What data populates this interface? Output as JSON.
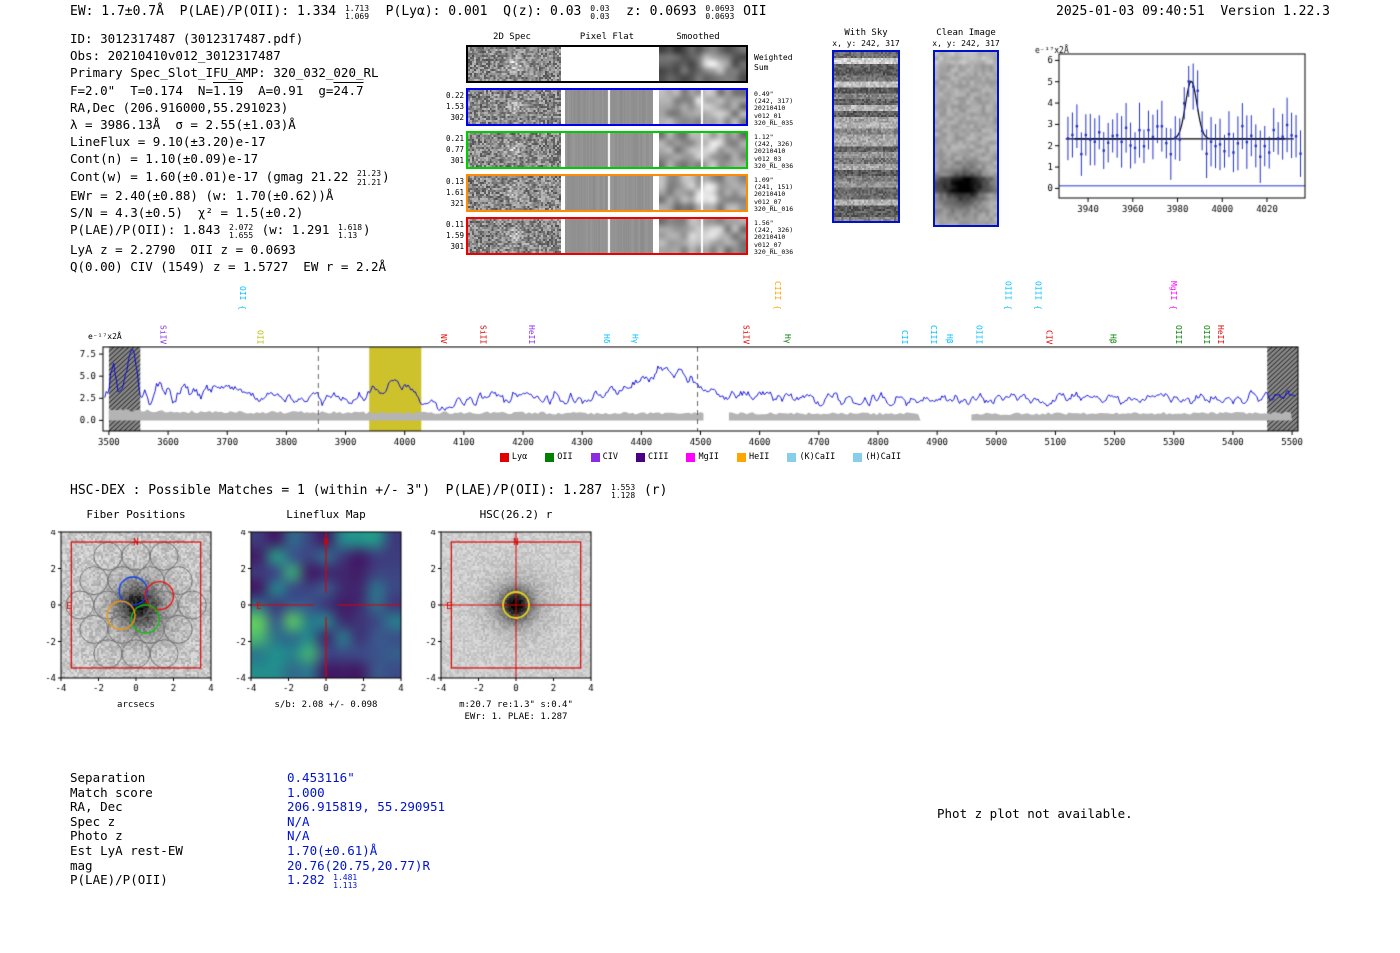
{
  "header": {
    "summary": [
      {
        "t": "EW: 1.7±0.7Å  P(LAE)/P(OII): 1.334 "
      },
      {
        "sup": "1.713",
        "sub": "1.069"
      },
      {
        "t": "  P(Lyα): 0.001  Q(z): 0.03 "
      },
      {
        "sup": "0.03",
        "sub": "0.03"
      },
      {
        "t": "  z: 0.0693 "
      },
      {
        "sup": "0.0693",
        "sub": "0.0693"
      },
      {
        "t": " OII"
      }
    ],
    "timestamp_version": "2025-01-03 09:40:51  Version 1.22.3"
  },
  "info": {
    "lines": [
      [
        {
          "t": "ID: 3012317487 (3012317487.pdf)"
        }
      ],
      [
        {
          "t": "Obs: 20210410v012_3012317487"
        }
      ],
      [
        {
          "t": "Primary Spec_Slot_IFU_AMP: 320_032_020_RL"
        }
      ],
      [
        {
          "t": "F=2.0\"  T=0.174  N="
        },
        {
          "t": "1.19",
          "bar": true
        },
        {
          "t": "  A=0.91  g="
        },
        {
          "t": "24.7",
          "bar": true
        }
      ],
      [
        {
          "t": "RA,Dec (206.916000,55.291023)"
        }
      ],
      [
        {
          "t": "λ = 3986.13Å  σ = 2.55(±1.03)Å"
        }
      ],
      [
        {
          "t": "LineFlux = 9.10(±3.20)e-17"
        }
      ],
      [
        {
          "t": "Cont(n) = 1.10(±0.09)e-17"
        }
      ],
      [
        {
          "t": "Cont(w) = 1.60(±0.01)e-17 (gmag 21.22 "
        },
        {
          "sup": "21.23",
          "sub": "21.21"
        },
        {
          "t": ")"
        }
      ],
      [
        {
          "t": "EWr = 2.40(±0.88) (w: 1.70(±0.62))Å"
        }
      ],
      [
        {
          "t": "S/N = 4.3(±0.5)  χ² = 1.5(±0.2)"
        }
      ],
      [
        {
          "t": "P(LAE)/P(OII): 1.843 "
        },
        {
          "sup": "2.072",
          "sub": "1.655"
        },
        {
          "t": " (w: 1.291 "
        },
        {
          "sup": "1.618",
          "sub": "1.13"
        },
        {
          "t": ")"
        }
      ],
      [
        {
          "t": "LyA z = 2.2790  OII z = 0.0693"
        }
      ],
      [
        {
          "t": "Q(0.00) CIV (1549) z = 1.5727  EW r = 2.2Å"
        }
      ]
    ]
  },
  "spec2d": {
    "col_headers": [
      "2D Spec",
      "Pixel Flat",
      "Smoothed"
    ],
    "rows": [
      {
        "border": "#000000",
        "left": [],
        "right": [
          "Weighted",
          "Sum"
        ]
      },
      {
        "border": "#0000ee",
        "left": [
          "0.22",
          "1.53",
          "302"
        ],
        "right": [
          "0.49\"",
          "(242, 317)",
          "20210410",
          "v012_01",
          "320_RL_035"
        ]
      },
      {
        "border": "#00cc00",
        "left": [
          "0.21",
          "0.77",
          "301"
        ],
        "right": [
          "1.12\"",
          "(242, 326)",
          "20210410",
          "v012_03",
          "320_RL_036"
        ]
      },
      {
        "border": "#ff8c00",
        "left": [
          "0.13",
          "1.61",
          "321"
        ],
        "right": [
          "1.09\"",
          "(241, 151)",
          "20210410",
          "v012_07",
          "320_RL_016"
        ]
      },
      {
        "border": "#ee0000",
        "left": [
          "0.11",
          "1.59",
          "301"
        ],
        "right": [
          "1.56\"",
          "(242, 326)",
          "20210410",
          "v012_07",
          "320_RL_036"
        ]
      }
    ]
  },
  "sky_cutouts": {
    "with_sky": {
      "title": "With Sky",
      "xy": "x, y: 242, 317"
    },
    "clean": {
      "title": "Clean Image",
      "xy": "x, y: 242, 317"
    }
  },
  "chart_data": [
    {
      "id": "zoom_spectrum",
      "type": "scatter",
      "ylabel": "e⁻¹⁷x2Å",
      "xlim": [
        3927,
        4037
      ],
      "ylim": [
        -0.45,
        6.3
      ],
      "xticks": [
        3940,
        3960,
        3980,
        4000,
        4020
      ],
      "yticks": [
        0,
        1,
        2,
        3,
        4,
        5,
        6
      ],
      "gaussian_fit": {
        "center": 3986.13,
        "sigma": 2.55,
        "amplitude": 2.7,
        "baseline": 2.32
      },
      "zero_line": 0.12,
      "points": {
        "x_start": 3931,
        "x_end": 4035,
        "step": 2,
        "noise": 0.85,
        "err_lo": 0.7,
        "err_hi": 1.3,
        "seed": 11
      },
      "point_color": "#2233cc",
      "fit_color": "#000000",
      "grid": false,
      "legend_position": "none"
    },
    {
      "id": "full_spectrum",
      "type": "line",
      "ylabel": "e⁻¹⁷x2Å",
      "xlim": [
        3490,
        5510
      ],
      "ylim": [
        -1.2,
        8.3
      ],
      "xticks": [
        3500,
        3600,
        3700,
        3800,
        3900,
        4000,
        4100,
        4200,
        4300,
        4400,
        4500,
        4600,
        4700,
        4800,
        4900,
        5000,
        5100,
        5200,
        5300,
        5400,
        5500
      ],
      "yticks": [
        0,
        2.5,
        5,
        7.5
      ],
      "line_color": "#0000dd",
      "grid": false,
      "legend_position": "bottom",
      "anchors": [
        [
          3490,
          3.5
        ],
        [
          3500,
          4.2
        ],
        [
          3508,
          6.8
        ],
        [
          3516,
          3.2
        ],
        [
          3526,
          5.2
        ],
        [
          3540,
          7.3
        ],
        [
          3550,
          4.2
        ],
        [
          3562,
          2.6
        ],
        [
          3580,
          3.2
        ],
        [
          3610,
          2.9
        ],
        [
          3645,
          3.1
        ],
        [
          3685,
          3.9
        ],
        [
          3710,
          3.2
        ],
        [
          3740,
          2.7
        ],
        [
          3775,
          2.5
        ],
        [
          3815,
          2.3
        ],
        [
          3855,
          2.5
        ],
        [
          3895,
          2.7
        ],
        [
          3935,
          2.9
        ],
        [
          3968,
          3.5
        ],
        [
          3986,
          4.9
        ],
        [
          4000,
          3.7
        ],
        [
          4022,
          2.6
        ],
        [
          4050,
          1.9
        ],
        [
          4070,
          1.5
        ],
        [
          4100,
          2.3
        ],
        [
          4150,
          2.5
        ],
        [
          4200,
          2.7
        ],
        [
          4245,
          2.4
        ],
        [
          4285,
          2.5
        ],
        [
          4330,
          2.9
        ],
        [
          4370,
          3.7
        ],
        [
          4405,
          4.8
        ],
        [
          4435,
          6.0
        ],
        [
          4465,
          5.2
        ],
        [
          4495,
          4.0
        ],
        [
          4530,
          3.1
        ],
        [
          4570,
          2.7
        ],
        [
          4630,
          2.6
        ],
        [
          4690,
          2.5
        ],
        [
          4750,
          2.45
        ],
        [
          4810,
          2.4
        ],
        [
          4870,
          2.35
        ],
        [
          4930,
          2.4
        ],
        [
          4990,
          2.45
        ],
        [
          5050,
          2.5
        ],
        [
          5110,
          2.45
        ],
        [
          5170,
          2.4
        ],
        [
          5230,
          2.5
        ],
        [
          5290,
          2.55
        ],
        [
          5350,
          2.5
        ],
        [
          5410,
          2.55
        ],
        [
          5470,
          2.7
        ],
        [
          5510,
          3.1
        ]
      ],
      "noise": {
        "amp": 0.5,
        "amp_blue": 0.85,
        "seed": 23
      },
      "error_band": {
        "anchors": [
          [
            3500,
            1.1
          ],
          [
            3600,
            0.95
          ],
          [
            3700,
            0.9
          ],
          [
            3850,
            0.85
          ],
          [
            4000,
            0.82
          ],
          [
            4200,
            0.8
          ],
          [
            4400,
            0.78
          ],
          [
            4600,
            0.75
          ],
          [
            4800,
            0.72
          ],
          [
            5000,
            0.72
          ],
          [
            5200,
            0.74
          ],
          [
            5400,
            0.78
          ],
          [
            5500,
            0.85
          ]
        ],
        "gaps": [
          [
            4505,
            4548
          ],
          [
            4872,
            4958
          ]
        ],
        "color": "#b4b4b4",
        "seed": 41
      },
      "highlight_band": {
        "x0": 3940,
        "x1": 4028,
        "color": "#cdc22b"
      },
      "dashed_lines": [
        3854,
        4495
      ],
      "edge_bands": [
        [
          3500,
          3553
        ],
        [
          5458,
          5510
        ]
      ],
      "line_labels": [
        {
          "wl": 3592,
          "text": "SiIV",
          "color": "#8a2be2",
          "tall": false
        },
        {
          "wl": 3727,
          "text": "OII {",
          "color": "#00bfff",
          "tall": true
        },
        {
          "wl": 3756,
          "text": "OII",
          "color": "#b8b800",
          "tall": false
        },
        {
          "wl": 4066,
          "text": "NV",
          "color": "#e00000",
          "tall": false
        },
        {
          "wl": 4133,
          "text": "SiII",
          "color": "#e00000",
          "tall": false
        },
        {
          "wl": 4215,
          "text": "HeII",
          "color": "#8a2be2",
          "tall": false
        },
        {
          "wl": 4342,
          "text": "Hδ",
          "color": "#00bfff",
          "tall": false
        },
        {
          "wl": 4390,
          "text": "Hγ",
          "color": "#00bfff",
          "tall": false
        },
        {
          "wl": 4578,
          "text": "SiIV",
          "color": "#e00000",
          "tall": false
        },
        {
          "wl": 4631,
          "text": "CIII {",
          "color": "#ffa500",
          "tall": true
        },
        {
          "wl": 4648,
          "text": "Hγ",
          "color": "#008000",
          "tall": false
        },
        {
          "wl": 4846,
          "text": "CII",
          "color": "#00bfff",
          "tall": false
        },
        {
          "wl": 4895,
          "text": "CIII",
          "color": "#00bfff",
          "tall": false
        },
        {
          "wl": 4922,
          "text": "Hβ",
          "color": "#00bfff",
          "tall": false
        },
        {
          "wl": 4972,
          "text": "OIII",
          "color": "#00bfff",
          "tall": false
        },
        {
          "wl": 5021,
          "text": "OIII {",
          "color": "#00bfff",
          "tall": true
        },
        {
          "wl": 5071,
          "text": "OIII {",
          "color": "#00bfff",
          "tall": true
        },
        {
          "wl": 5090,
          "text": "CIV",
          "color": "#e00000",
          "tall": false
        },
        {
          "wl": 5198,
          "text": "Hβ",
          "color": "#008000",
          "tall": false
        },
        {
          "wl": 5300,
          "text": "MgII {",
          "color": "#ff00ff",
          "tall": true
        },
        {
          "wl": 5309,
          "text": "OIII",
          "color": "#008000",
          "tall": false
        },
        {
          "wl": 5356,
          "text": "OIII",
          "color": "#008000",
          "tall": false
        },
        {
          "wl": 5380,
          "text": "HeII",
          "color": "#e00000",
          "tall": false
        }
      ],
      "legend": [
        {
          "label": "Lyα",
          "color": "#e00000"
        },
        {
          "label": "OII",
          "color": "#008000"
        },
        {
          "label": "CIV",
          "color": "#8a2be2"
        },
        {
          "label": "CIII",
          "color": "#4b0082"
        },
        {
          "label": "MgII",
          "color": "#ff00ff"
        },
        {
          "label": "HeII",
          "color": "#ffa500"
        },
        {
          "label": "(K)CaII",
          "color": "#87ceeb"
        },
        {
          "label": "(H)CaII",
          "color": "#87ceeb"
        }
      ]
    }
  ],
  "hsc_dex": {
    "summary": [
      {
        "t": "HSC-DEX : Possible Matches = 1 (within +/- 3\")  P(LAE)/P(OII): 1.287 "
      },
      {
        "sup": "1.553",
        "sub": "1.128"
      },
      {
        "t": " (r)"
      }
    ]
  },
  "panels": {
    "fiber": {
      "title": "Fiber Positions",
      "xlabel": "arcsecs",
      "xticks": [
        -4,
        -2,
        0,
        2,
        4
      ],
      "yticks": [
        -4,
        -2,
        0,
        2,
        4
      ],
      "compass_n": "N",
      "compass_e": "E"
    },
    "lineflux": {
      "title": "Lineflux Map",
      "xlabel": "s/b: 2.08 +/- 0.098",
      "xticks": [
        -4,
        -2,
        0,
        2,
        4
      ],
      "yticks": [
        -4,
        -2,
        0,
        2,
        4
      ],
      "compass_n": "N",
      "compass_e": "E"
    },
    "hsc": {
      "title": "HSC(26.2) r",
      "xlabel": "m:20.7 re:1.3\" s:0.4\"",
      "xlabel2": "EWr: 1. PLAE: 1.287",
      "xticks": [
        -4,
        -2,
        0,
        2,
        4
      ],
      "yticks": [
        -4,
        -2,
        0,
        2,
        4
      ],
      "compass_n": "N",
      "compass_e": "E"
    }
  },
  "match_table": {
    "rows": [
      {
        "label": "Separation",
        "value": "0.453116\""
      },
      {
        "label": "Match score",
        "value": "1.000"
      },
      {
        "label": "RA, Dec",
        "value": "206.915819, 55.290951"
      },
      {
        "label": "Spec z",
        "value": "N/A"
      },
      {
        "label": "Photo z",
        "value": "N/A"
      },
      {
        "label": "Est LyA rest-EW",
        "value": "1.70(±0.61)Å"
      },
      {
        "label": "mag",
        "value": "20.76(20.75,20.77)R"
      },
      {
        "label": "P(LAE)/P(OII)",
        "value": "1.282 ",
        "sup": "1.481",
        "sub": "1.113"
      }
    ]
  },
  "photz_note": "Phot z plot not available."
}
